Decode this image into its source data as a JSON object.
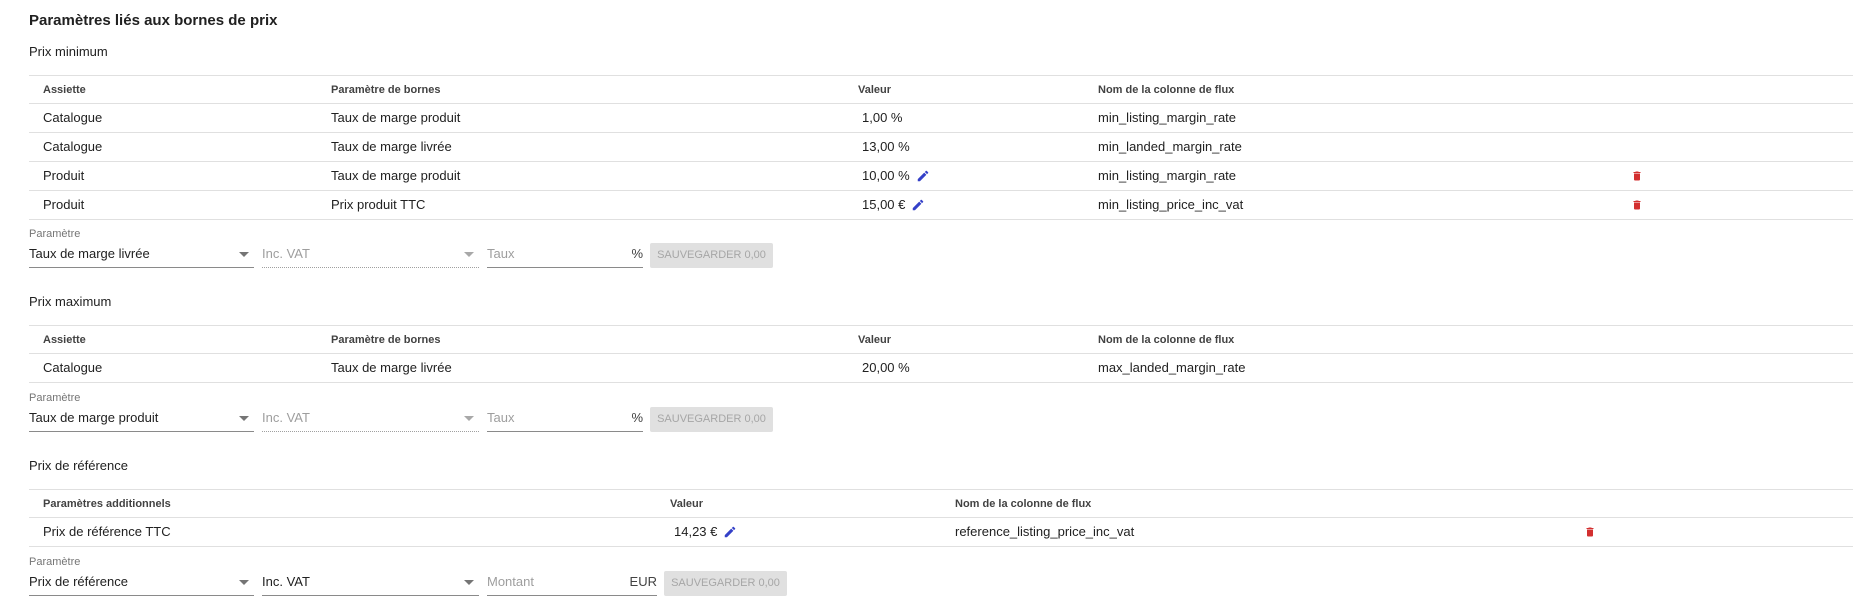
{
  "page_title": "Paramètres liés aux bornes de prix",
  "colors": {
    "pencil": "#3440c8",
    "trash": "#d32f2f",
    "border": "#e0e0e0",
    "disabled_bg": "#e0e0e0"
  },
  "min_section": {
    "title": "Prix minimum",
    "headers": {
      "assiette": "Assiette",
      "parametre": "Paramètre de bornes",
      "valeur": "Valeur",
      "colonne": "Nom de la colonne de flux"
    },
    "rows": [
      {
        "assiette": "Catalogue",
        "parametre": "Taux de marge produit",
        "valeur": "1,00 %",
        "colonne": "min_listing_margin_rate",
        "editable": false,
        "deletable": false
      },
      {
        "assiette": "Catalogue",
        "parametre": "Taux de marge livrée",
        "valeur": "13,00 %",
        "colonne": "min_landed_margin_rate",
        "editable": false,
        "deletable": false
      },
      {
        "assiette": "Produit",
        "parametre": "Taux de marge produit",
        "valeur": "10,00 %",
        "colonne": "min_listing_margin_rate",
        "editable": true,
        "deletable": true
      },
      {
        "assiette": "Produit",
        "parametre": "Prix produit TTC",
        "valeur": "15,00 €",
        "colonne": "min_listing_price_inc_vat",
        "editable": true,
        "deletable": true
      }
    ],
    "form": {
      "label": "Paramètre",
      "parametre_value": "Taux de marge livrée",
      "vat_placeholder": "Inc. VAT",
      "taux_placeholder": "Taux",
      "taux_suffix": "%",
      "save_label": "SAUVEGARDER 0,00"
    }
  },
  "max_section": {
    "title": "Prix maximum",
    "headers": {
      "assiette": "Assiette",
      "parametre": "Paramètre de bornes",
      "valeur": "Valeur",
      "colonne": "Nom de la colonne de flux"
    },
    "rows": [
      {
        "assiette": "Catalogue",
        "parametre": "Taux de marge livrée",
        "valeur": "20,00 %",
        "colonne": "max_landed_margin_rate"
      }
    ],
    "form": {
      "label": "Paramètre",
      "parametre_value": "Taux de marge produit",
      "vat_placeholder": "Inc. VAT",
      "taux_placeholder": "Taux",
      "taux_suffix": "%",
      "save_label": "SAUVEGARDER 0,00"
    }
  },
  "ref_section": {
    "title": "Prix de référence",
    "headers": {
      "parametre": "Paramètres additionnels",
      "valeur": "Valeur",
      "colonne": "Nom de la colonne de flux"
    },
    "rows": [
      {
        "parametre": "Prix de référence TTC",
        "valeur": "14,23 €",
        "colonne": "reference_listing_price_inc_vat",
        "editable": true,
        "deletable": true
      }
    ],
    "form": {
      "label": "Paramètre",
      "parametre_value": "Prix de référence",
      "vat_value": "Inc. VAT",
      "montant_placeholder": "Montant",
      "montant_suffix": "EUR",
      "save_label": "SAUVEGARDER 0,00"
    }
  }
}
